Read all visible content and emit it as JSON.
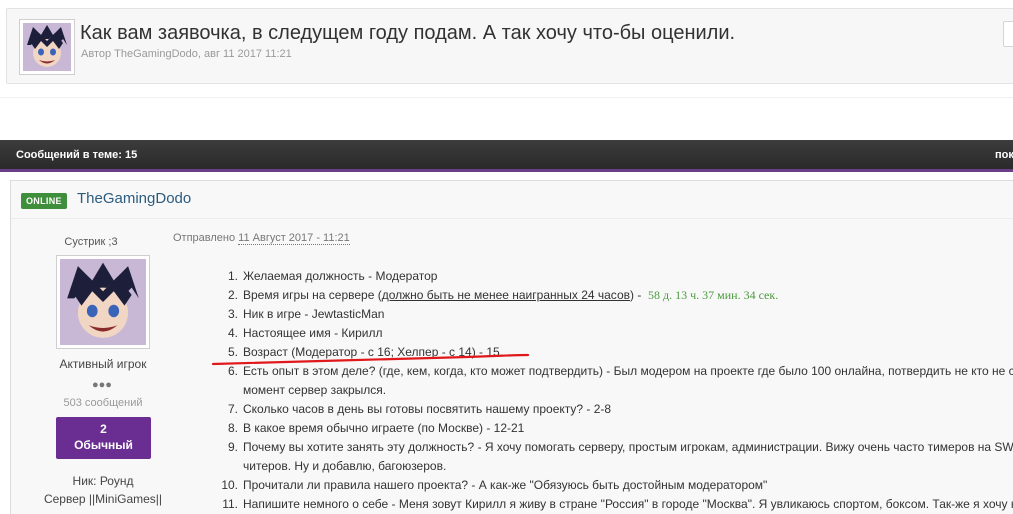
{
  "topic": {
    "title": "Как вам заявочка, в следущем году подам. А так хочу что-бы оценили.",
    "meta": "Автор TheGamingDodo, авг 11 2017 11:21"
  },
  "bar": {
    "count": "Сообщений в теме: 15",
    "right": "пок"
  },
  "post": {
    "online": "ONLINE",
    "author": "TheGamingDodo",
    "user_title": "Сустрик ;3",
    "rank": "Активный игрок",
    "pips": "●●●",
    "post_count": "503 сообщений",
    "rep_value": "2",
    "rep_label": "Обычный",
    "nick": "Ник: Роунд",
    "server": "Сервер ||MiniGames||",
    "posted_prefix": "Отправлено",
    "posted_date": "11 Август 2017 - 11:21",
    "items": [
      {
        "num": "1.",
        "text": "Желаемая должность - Модератор"
      },
      {
        "num": "2.",
        "pre": "Время игры на сервере (",
        "u": "должно быть не менее наигранных 24 часов",
        "post": ") -",
        "green": "58 д. 13 ч. 37 мин. 34 сек."
      },
      {
        "num": "3.",
        "text": "Ник в игре -  JewtasticMan"
      },
      {
        "num": "4.",
        "text": "Настоящее имя - Кирилл"
      },
      {
        "num": "5.",
        "text": "Возраст  (Модератор - с 16; Хелпер - с 14) - 15."
      },
      {
        "num": "6.",
        "text": "Есть опыт в этом деле? (где, кем, когда, кто может подтвердить) - Был модером на проекте где было 100 онлайна, потвердить не кто не см",
        "text2": "момент сервер закрылся."
      },
      {
        "num": "7.",
        "text": "Сколько часов в день вы готовы посвятить нашему проекту? - 2-8"
      },
      {
        "num": "8.",
        "text": "В какое время обычно играете (по Москве) - 12-21"
      },
      {
        "num": "9.",
        "text": "Почему вы хотите занять эту должность? - Я хочу помогать серверу, простым игрокам, администрации. Вижу очень часто тимеров на SWS",
        "text2": "читеров. Ну и добавлю, багоюзеров."
      },
      {
        "num": "10.",
        "text": "Прочитали ли правила нашего проекта? - А как-же \"Обязуюсь быть достойным модератором\""
      },
      {
        "num": "11.",
        "text": "Напишите немного о себе - Меня зовут Кирилл я живу в стране \"Россия\" в городе \"Москва\". Я увликаюсь спортом, боксом. Так-же я хочу н"
      }
    ]
  }
}
